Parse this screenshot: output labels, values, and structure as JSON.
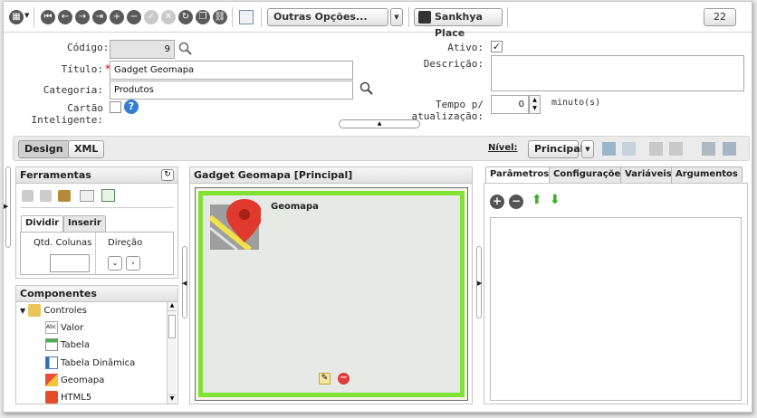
{
  "toolbar": {
    "more_options": "Outras Opções...",
    "place": "Sankhya Place",
    "record_count": "22"
  },
  "form": {
    "codigo_label": "Código:",
    "codigo_value": "9",
    "titulo_label": "Título:",
    "titulo_value": "Gadget Geomapa",
    "categoria_label": "Categoria:",
    "categoria_value": "Produtos",
    "cartao_label": "Cartão Inteligente:",
    "ativo_label": "Ativo:",
    "ativo_checked": true,
    "descricao_label": "Descrição:",
    "tempo_label": "Tempo p/ atualização:",
    "tempo_value": "0",
    "tempo_unit": "minuto(s)"
  },
  "design_bar": {
    "tab_design": "Design",
    "tab_xml": "XML",
    "nivel_label": "Nível:",
    "nivel_value": "Principal"
  },
  "ferramentas": {
    "title": "Ferramentas",
    "tab_dividir": "Dividir",
    "tab_inserir": "Inserir",
    "col_qtd": "Qtd. Colunas",
    "col_direcao": "Direção"
  },
  "componentes": {
    "title": "Componentes",
    "root": "Controles",
    "items": [
      "Valor",
      "Tabela",
      "Tabela Dinâmica",
      "Geomapa",
      "HTML5"
    ]
  },
  "canvas": {
    "title": "Gadget Geomapa [Principal]",
    "component_label": "Geomapa"
  },
  "right_panel": {
    "tabs": [
      "Parâmetros",
      "Configurações",
      "Variáveis",
      "Argumentos"
    ]
  }
}
